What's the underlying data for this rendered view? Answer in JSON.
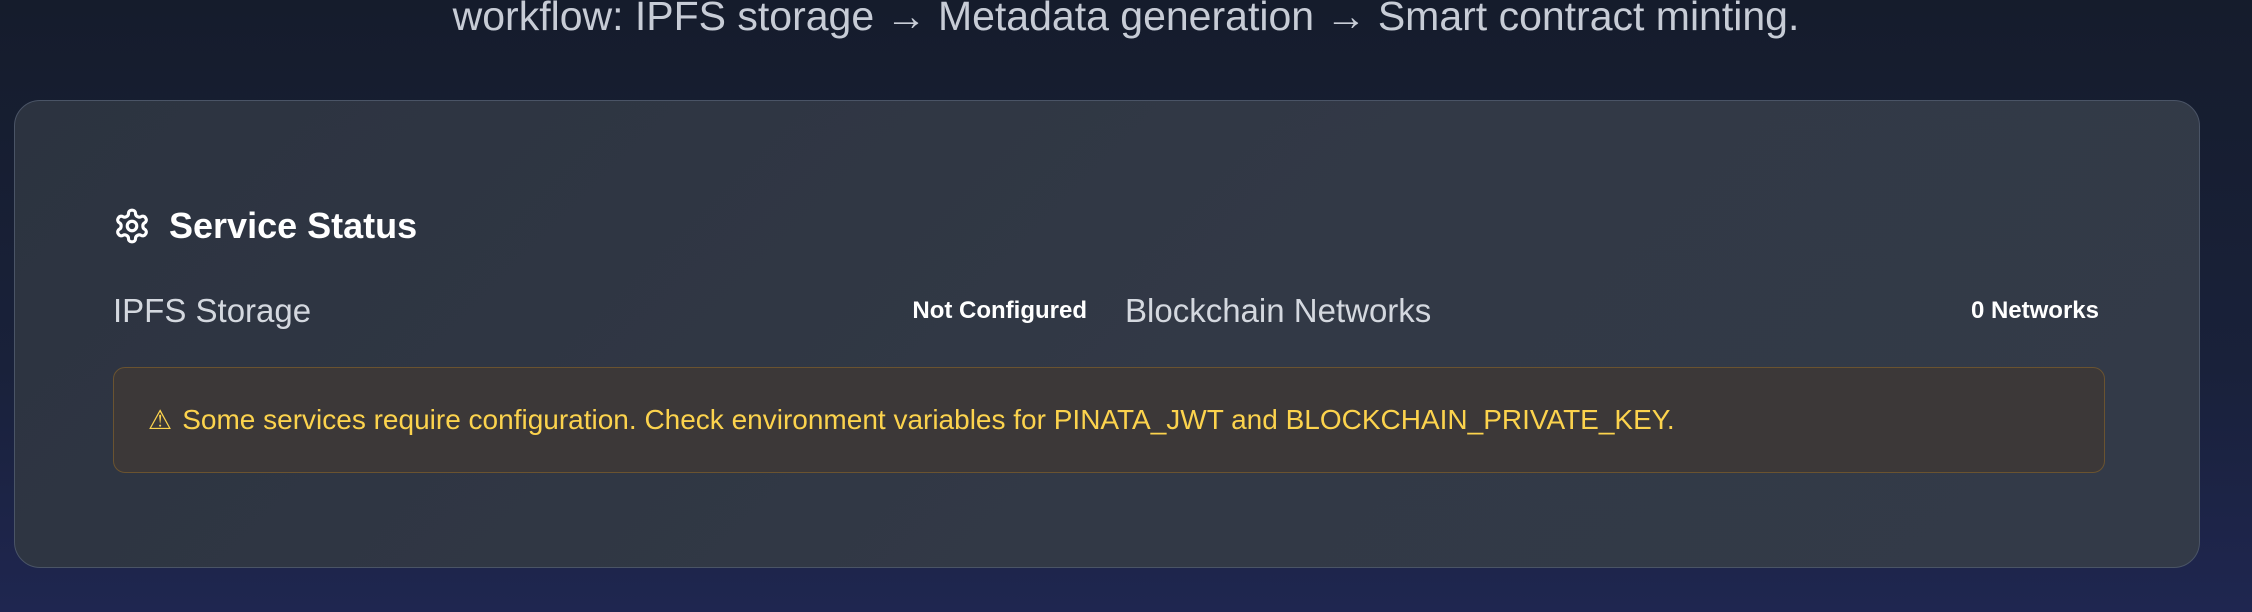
{
  "header": {
    "subtitle": "workflow: IPFS storage → Metadata generation → Smart contract minting."
  },
  "service_status": {
    "title": "Service Status",
    "icon": "gear-icon",
    "ipfs": {
      "label": "IPFS Storage",
      "value": "Not Configured"
    },
    "blockchain": {
      "label": "Blockchain Networks",
      "value": "0 Networks"
    },
    "warning": {
      "icon": "warning-icon",
      "symbol": "⚠",
      "text": "Some services require configuration. Check environment variables for PINATA_JWT and BLOCKCHAIN_PRIVATE_KEY."
    }
  },
  "colors": {
    "warning_text": "#fcd34d",
    "card_border": "#4a5466",
    "background": "#19213a"
  }
}
